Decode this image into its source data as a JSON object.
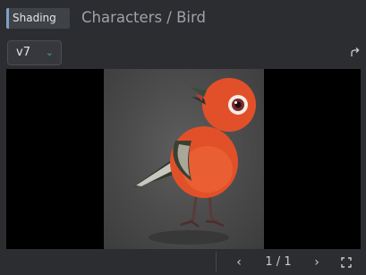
{
  "header": {
    "tag_label": "Shading",
    "breadcrumb": "Characters / Bird"
  },
  "toolbar": {
    "version_value": "v7",
    "share_icon": "share-arrow-icon"
  },
  "viewer": {
    "image_subject": "bird-render",
    "colors": {
      "bird_body": "#e2502a",
      "background": "#4b4b4b",
      "letterbox": "#000000"
    }
  },
  "pager": {
    "prev_icon": "chevron-left-icon",
    "counter_text": "1 / 1",
    "next_icon": "chevron-right-icon",
    "fullscreen_icon": "fullscreen-icon"
  }
}
